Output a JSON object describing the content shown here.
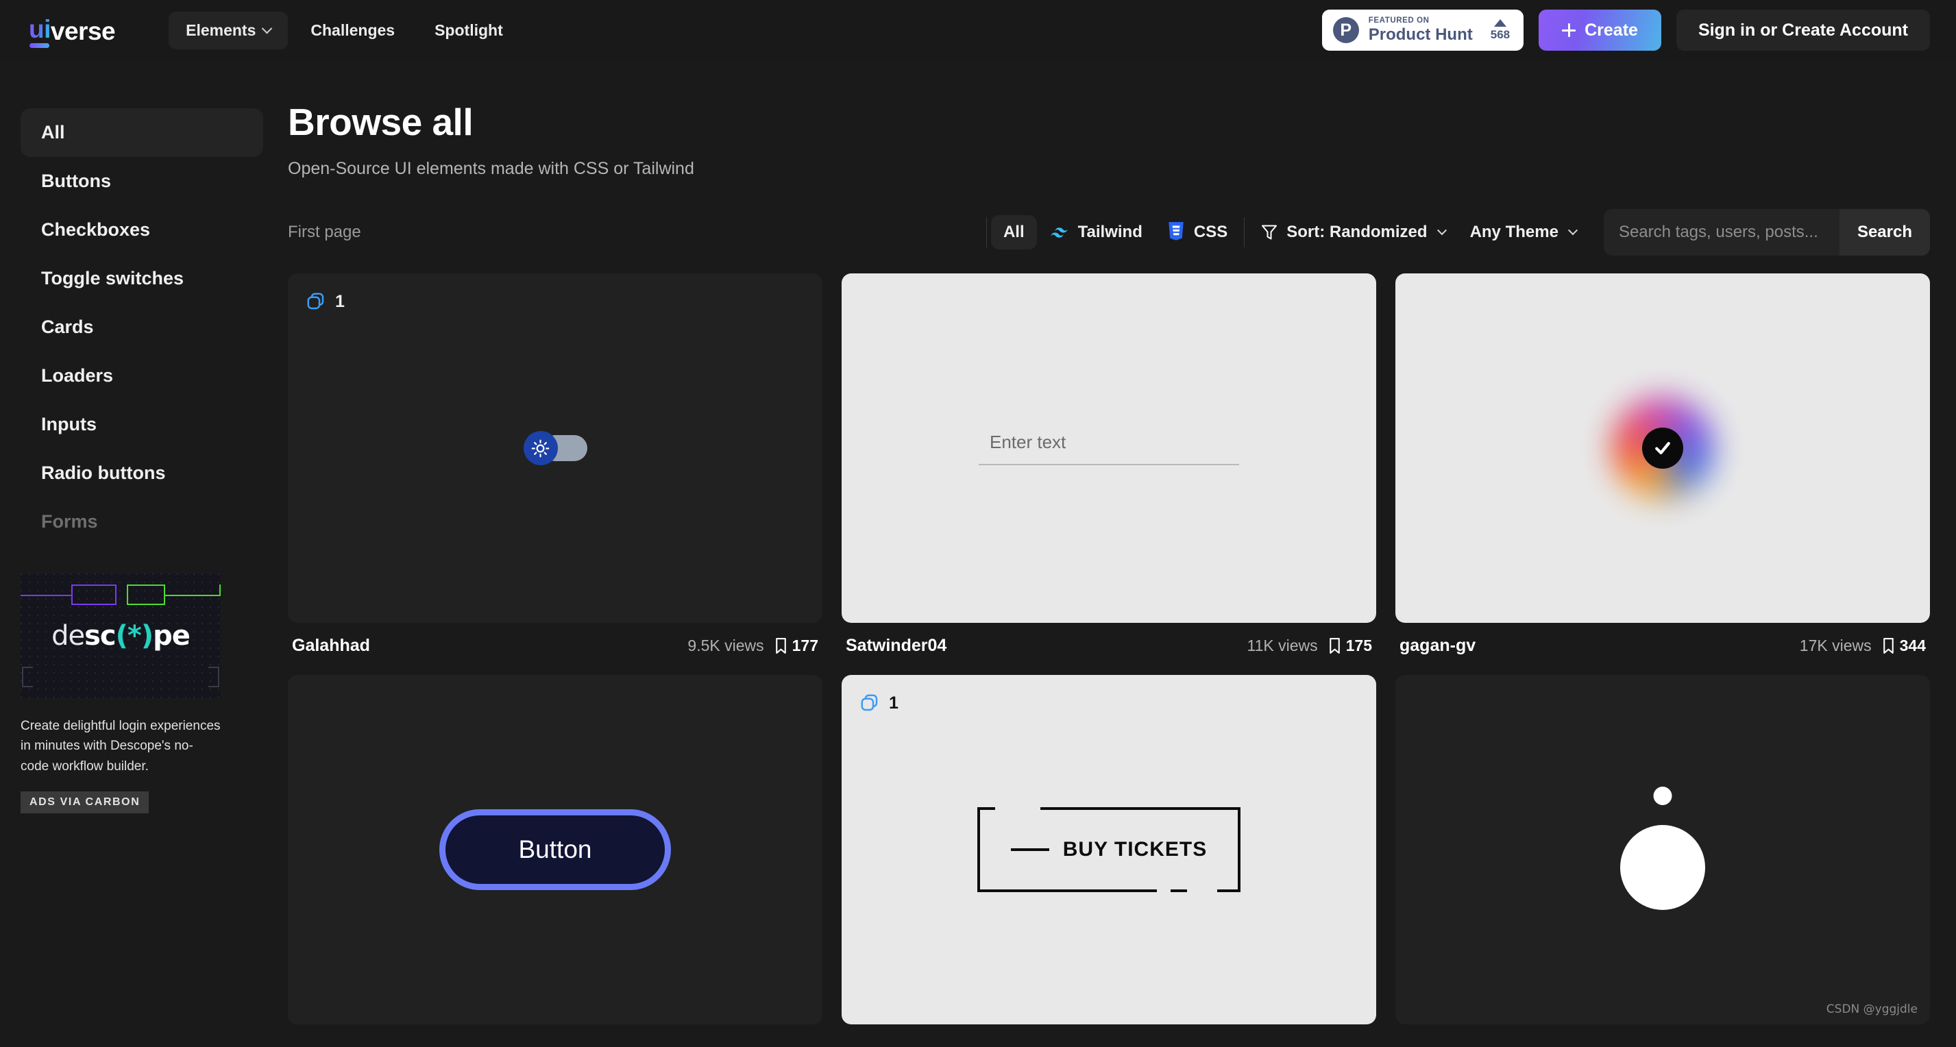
{
  "header": {
    "logo_ui": "ui",
    "logo_verse": "verse",
    "nav": [
      {
        "label": "Elements",
        "has_chevron": true,
        "active": true
      },
      {
        "label": "Challenges",
        "has_chevron": false,
        "active": false
      },
      {
        "label": "Spotlight",
        "has_chevron": false,
        "active": false
      }
    ],
    "product_hunt": {
      "mark": "P",
      "featured_on": "FEATURED ON",
      "name": "Product Hunt",
      "votes": "568"
    },
    "create_label": "Create",
    "signin_label": "Sign in or Create Account"
  },
  "sidebar": {
    "items": [
      {
        "label": "All",
        "active": true,
        "faded": false
      },
      {
        "label": "Buttons",
        "active": false,
        "faded": false
      },
      {
        "label": "Checkboxes",
        "active": false,
        "faded": false
      },
      {
        "label": "Toggle switches",
        "active": false,
        "faded": false
      },
      {
        "label": "Cards",
        "active": false,
        "faded": false
      },
      {
        "label": "Loaders",
        "active": false,
        "faded": false
      },
      {
        "label": "Inputs",
        "active": false,
        "faded": false
      },
      {
        "label": "Radio buttons",
        "active": false,
        "faded": false
      },
      {
        "label": "Forms",
        "active": false,
        "faded": true
      }
    ],
    "ad": {
      "logo_part1": "de",
      "logo_part2": "sc",
      "logo_star": "(*)",
      "logo_part3": "pe",
      "body": "Create delightful login experiences in minutes with Descope's no-code workflow builder.",
      "tag": "ADS VIA CARBON"
    }
  },
  "main": {
    "title": "Browse all",
    "subtitle": "Open-Source UI elements made with CSS or Tailwind",
    "first_page": "First page",
    "filters": {
      "all": "All",
      "tailwind": "Tailwind",
      "css": "CSS",
      "sort": "Sort: Randomized",
      "theme": "Any Theme"
    },
    "search": {
      "placeholder": "Search tags, users, posts...",
      "value": "",
      "button": "Search"
    },
    "cards": [
      {
        "author": "Galahhad",
        "views": "9.5K views",
        "bookmarks": "177",
        "badge": "1",
        "has_badge": true,
        "theme": "dark",
        "preview": "toggle-switch"
      },
      {
        "author": "Satwinder04",
        "views": "11K views",
        "bookmarks": "175",
        "badge": "",
        "has_badge": false,
        "theme": "light",
        "preview": "text-input",
        "preview_text": "Enter text"
      },
      {
        "author": "gagan-gv",
        "views": "17K views",
        "bookmarks": "344",
        "badge": "",
        "has_badge": false,
        "theme": "light",
        "preview": "glow-checkmark"
      },
      {
        "author": "",
        "views": "",
        "bookmarks": "",
        "badge": "",
        "has_badge": false,
        "theme": "dark",
        "preview": "outline-button",
        "preview_text": "Button"
      },
      {
        "author": "",
        "views": "",
        "bookmarks": "",
        "badge": "1",
        "has_badge": true,
        "theme": "light",
        "preview": "ticket-button",
        "preview_text": "BUY TICKETS"
      },
      {
        "author": "",
        "views": "",
        "bookmarks": "",
        "badge": "",
        "has_badge": false,
        "theme": "dark",
        "preview": "ball-loader"
      }
    ]
  },
  "watermark": "CSDN @yggjdle",
  "colors": {
    "page_bg": "#1a1a1a",
    "header_bg": "#191919",
    "card_dark": "#212121",
    "card_light": "#e8e8e8",
    "accent_purple": "#8b5cf6",
    "accent_cyan": "#4fb3e8",
    "tailwind_blue": "#38bdf8",
    "css_blue": "#2965f1",
    "badge_blue": "#3b9cf5",
    "product_hunt_navy": "#4b587c"
  }
}
